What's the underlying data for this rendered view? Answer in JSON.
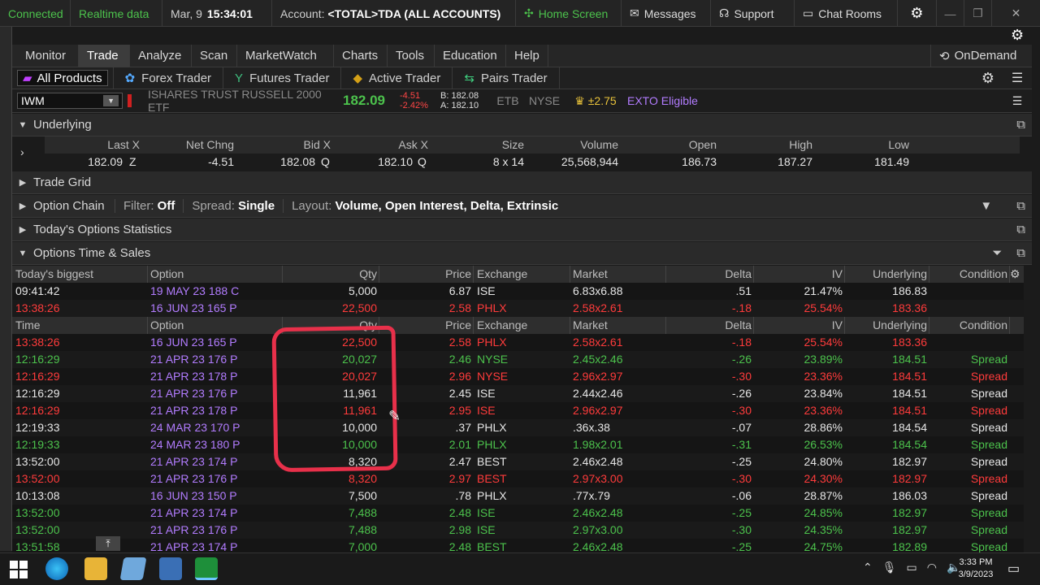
{
  "status": {
    "connection": "Connected",
    "data_mode": "Realtime data",
    "date": "Mar, 9",
    "time": "15:34:01",
    "account_label": "Account:",
    "account_value": "<TOTAL>TDA (ALL ACCOUNTS)",
    "home_screen": "Home Screen",
    "messages": "Messages",
    "support": "Support",
    "chat_rooms": "Chat Rooms"
  },
  "menu": {
    "tabs": [
      "Monitor",
      "Trade",
      "Analyze",
      "Scan",
      "MarketWatch",
      "Charts",
      "Tools",
      "Education",
      "Help"
    ],
    "active": "Trade",
    "ondemand": "OnDemand"
  },
  "subtabs": [
    "All Products",
    "Forex Trader",
    "Futures Trader",
    "Active Trader",
    "Pairs Trader"
  ],
  "quote": {
    "symbol": "IWM",
    "name": "ISHARES TRUST RUSSELL 2000 ETF",
    "last": "182.09",
    "change": "-4.51",
    "change_pct": "-2.42%",
    "bid": "B: 182.08",
    "ask": "A: 182.10",
    "etb": "ETB",
    "exchange": "NYSE",
    "move": "±2.75",
    "exto": "EXTO Eligible"
  },
  "underlying": {
    "title": "Underlying",
    "headers": [
      "Last X",
      "Net Chng",
      "Bid X",
      "Ask X",
      "Size",
      "Volume",
      "Open",
      "High",
      "Low"
    ],
    "values": {
      "last": "182.09",
      "last_x": "Z",
      "net": "-4.51",
      "bid": "182.08",
      "bid_x": "Q",
      "ask": "182.10",
      "ask_x": "Q",
      "size": "8 x 14",
      "volume": "25,568,944",
      "open": "186.73",
      "high": "187.27",
      "low": "181.49"
    }
  },
  "sections": {
    "trade_grid": "Trade Grid",
    "option_chain": "Option Chain",
    "filter_label": "Filter:",
    "filter_value": "Off",
    "spread_label": "Spread:",
    "spread_value": "Single",
    "layout_label": "Layout:",
    "layout_value": "Volume, Open Interest, Delta, Extrinsic",
    "stats": "Today's Options Statistics",
    "ts": "Options Time & Sales"
  },
  "ts_headers_top": [
    "Today's biggest",
    "Option",
    "Qty",
    "Price",
    "Exchange",
    "Market",
    "Delta",
    "IV",
    "Underlying",
    "Condition"
  ],
  "ts_headers": [
    "Time",
    "Option",
    "Qty",
    "Price",
    "Exchange",
    "Market",
    "Delta",
    "IV",
    "Underlying",
    "Condition"
  ],
  "biggest_rows": [
    {
      "c": "white",
      "time": "09:41:42",
      "option": "19 MAY 23 188 C",
      "qty": "5,000",
      "price": "6.87",
      "exch": "ISE",
      "market": "6.83x6.88",
      "delta": ".51",
      "iv": "21.47%",
      "und": "186.83",
      "cond": ""
    },
    {
      "c": "red",
      "time": "13:38:26",
      "option": "16 JUN 23 165 P",
      "qty": "22,500",
      "price": "2.58",
      "exch": "PHLX",
      "market": "2.58x2.61",
      "delta": "-.18",
      "iv": "25.54%",
      "und": "183.36",
      "cond": ""
    }
  ],
  "rows": [
    {
      "c": "red",
      "time": "13:38:26",
      "option": "16 JUN 23 165 P",
      "qty": "22,500",
      "price": "2.58",
      "exch": "PHLX",
      "market": "2.58x2.61",
      "delta": "-.18",
      "iv": "25.54%",
      "und": "183.36",
      "cond": ""
    },
    {
      "c": "green",
      "time": "12:16:29",
      "option": "21 APR 23 176 P",
      "qty": "20,027",
      "price": "2.46",
      "exch": "NYSE",
      "market": "2.45x2.46",
      "delta": "-.26",
      "iv": "23.89%",
      "und": "184.51",
      "cond": "Spread"
    },
    {
      "c": "red",
      "time": "12:16:29",
      "option": "21 APR 23 178 P",
      "qty": "20,027",
      "price": "2.96",
      "exch": "NYSE",
      "market": "2.96x2.97",
      "delta": "-.30",
      "iv": "23.36%",
      "und": "184.51",
      "cond": "Spread"
    },
    {
      "c": "white",
      "time": "12:16:29",
      "option": "21 APR 23 176 P",
      "qty": "11,961",
      "price": "2.45",
      "exch": "ISE",
      "market": "2.44x2.46",
      "delta": "-.26",
      "iv": "23.84%",
      "und": "184.51",
      "cond": "Spread"
    },
    {
      "c": "red",
      "time": "12:16:29",
      "option": "21 APR 23 178 P",
      "qty": "11,961",
      "price": "2.95",
      "exch": "ISE",
      "market": "2.96x2.97",
      "delta": "-.30",
      "iv": "23.36%",
      "und": "184.51",
      "cond": "Spread"
    },
    {
      "c": "white",
      "time": "12:19:33",
      "option": "24 MAR 23 170 P",
      "qty": "10,000",
      "price": ".37",
      "exch": "PHLX",
      "market": ".36x.38",
      "delta": "-.07",
      "iv": "28.86%",
      "und": "184.54",
      "cond": "Spread"
    },
    {
      "c": "green",
      "time": "12:19:33",
      "option": "24 MAR 23 180 P",
      "qty": "10,000",
      "price": "2.01",
      "exch": "PHLX",
      "market": "1.98x2.01",
      "delta": "-.31",
      "iv": "26.53%",
      "und": "184.54",
      "cond": "Spread"
    },
    {
      "c": "white",
      "time": "13:52:00",
      "option": "21 APR 23 174 P",
      "qty": "8,320",
      "price": "2.47",
      "exch": "BEST",
      "market": "2.46x2.48",
      "delta": "-.25",
      "iv": "24.80%",
      "und": "182.97",
      "cond": "Spread"
    },
    {
      "c": "red",
      "time": "13:52:00",
      "option": "21 APR 23 176 P",
      "qty": "8,320",
      "price": "2.97",
      "exch": "BEST",
      "market": "2.97x3.00",
      "delta": "-.30",
      "iv": "24.30%",
      "und": "182.97",
      "cond": "Spread"
    },
    {
      "c": "white",
      "time": "10:13:08",
      "option": "16 JUN 23 150 P",
      "qty": "7,500",
      "price": ".78",
      "exch": "PHLX",
      "market": ".77x.79",
      "delta": "-.06",
      "iv": "28.87%",
      "und": "186.03",
      "cond": "Spread"
    },
    {
      "c": "green",
      "time": "13:52:00",
      "option": "21 APR 23 174 P",
      "qty": "7,488",
      "price": "2.48",
      "exch": "ISE",
      "market": "2.46x2.48",
      "delta": "-.25",
      "iv": "24.85%",
      "und": "182.97",
      "cond": "Spread"
    },
    {
      "c": "green",
      "time": "13:52:00",
      "option": "21 APR 23 176 P",
      "qty": "7,488",
      "price": "2.98",
      "exch": "ISE",
      "market": "2.97x3.00",
      "delta": "-.30",
      "iv": "24.35%",
      "und": "182.97",
      "cond": "Spread"
    },
    {
      "c": "green",
      "time": "13:51:58",
      "option": "21 APR 23 174 P",
      "qty": "7,000",
      "price": "2.48",
      "exch": "BEST",
      "market": "2.46x2.48",
      "delta": "-.25",
      "iv": "24.75%",
      "und": "182.89",
      "cond": "Spread"
    }
  ],
  "taskbar": {
    "time": "3:33 PM",
    "date": "3/9/2023"
  },
  "colors": {
    "green": "#4cc24c",
    "red": "#ff3b3b",
    "purple": "#b27cff",
    "white": "#e6e6e6",
    "highlight": "#e8304a"
  }
}
